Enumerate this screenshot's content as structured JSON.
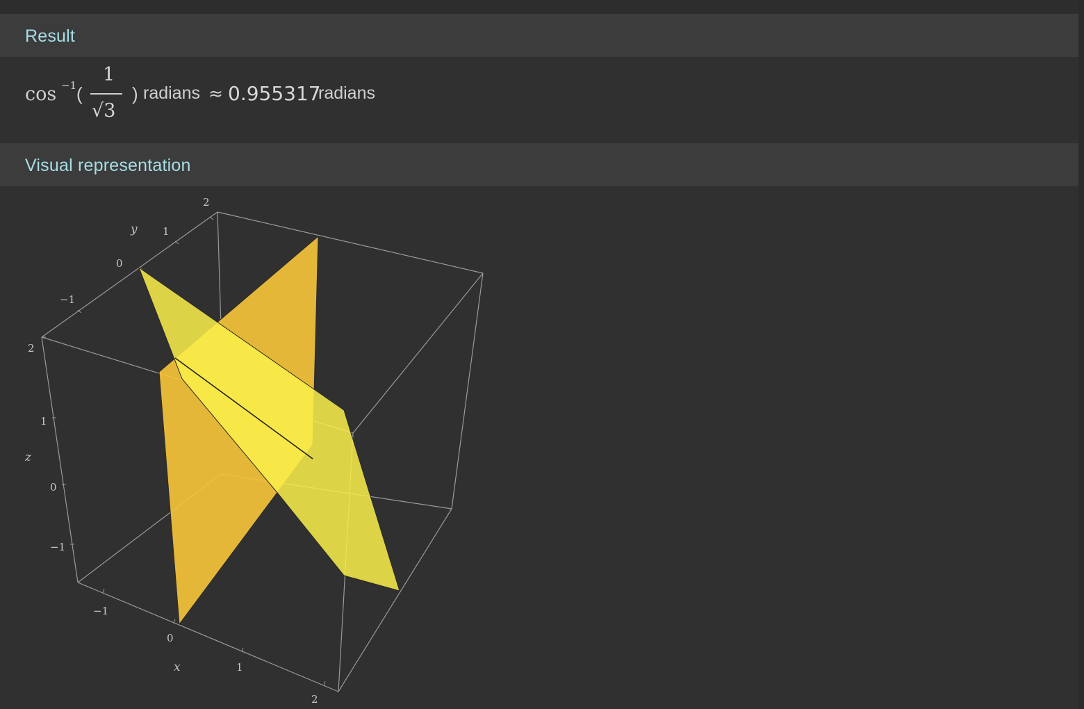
{
  "sections": {
    "result": {
      "title": "Result",
      "formula": {
        "func": "cos",
        "superscript": "−1",
        "lparen": "(",
        "numerator": "1",
        "denominator": "√3",
        "rparen": ")",
        "unit": "radians",
        "approx": "≈",
        "value": "0.955317",
        "value_unit": "radians"
      }
    },
    "visual": {
      "title": "Visual representation",
      "axes": {
        "x_label": "x",
        "y_label": "y",
        "z_label": "z",
        "x_ticks": [
          "−1",
          "0",
          "1",
          "2"
        ],
        "y_ticks": [
          "−1",
          "0",
          "1",
          "2"
        ],
        "z_ticks": [
          "−1",
          "0",
          "1",
          "2"
        ]
      },
      "colors": {
        "plane_a": "#f5c33b",
        "plane_b": "#faf04a",
        "box": "#9a9a9a"
      }
    }
  }
}
